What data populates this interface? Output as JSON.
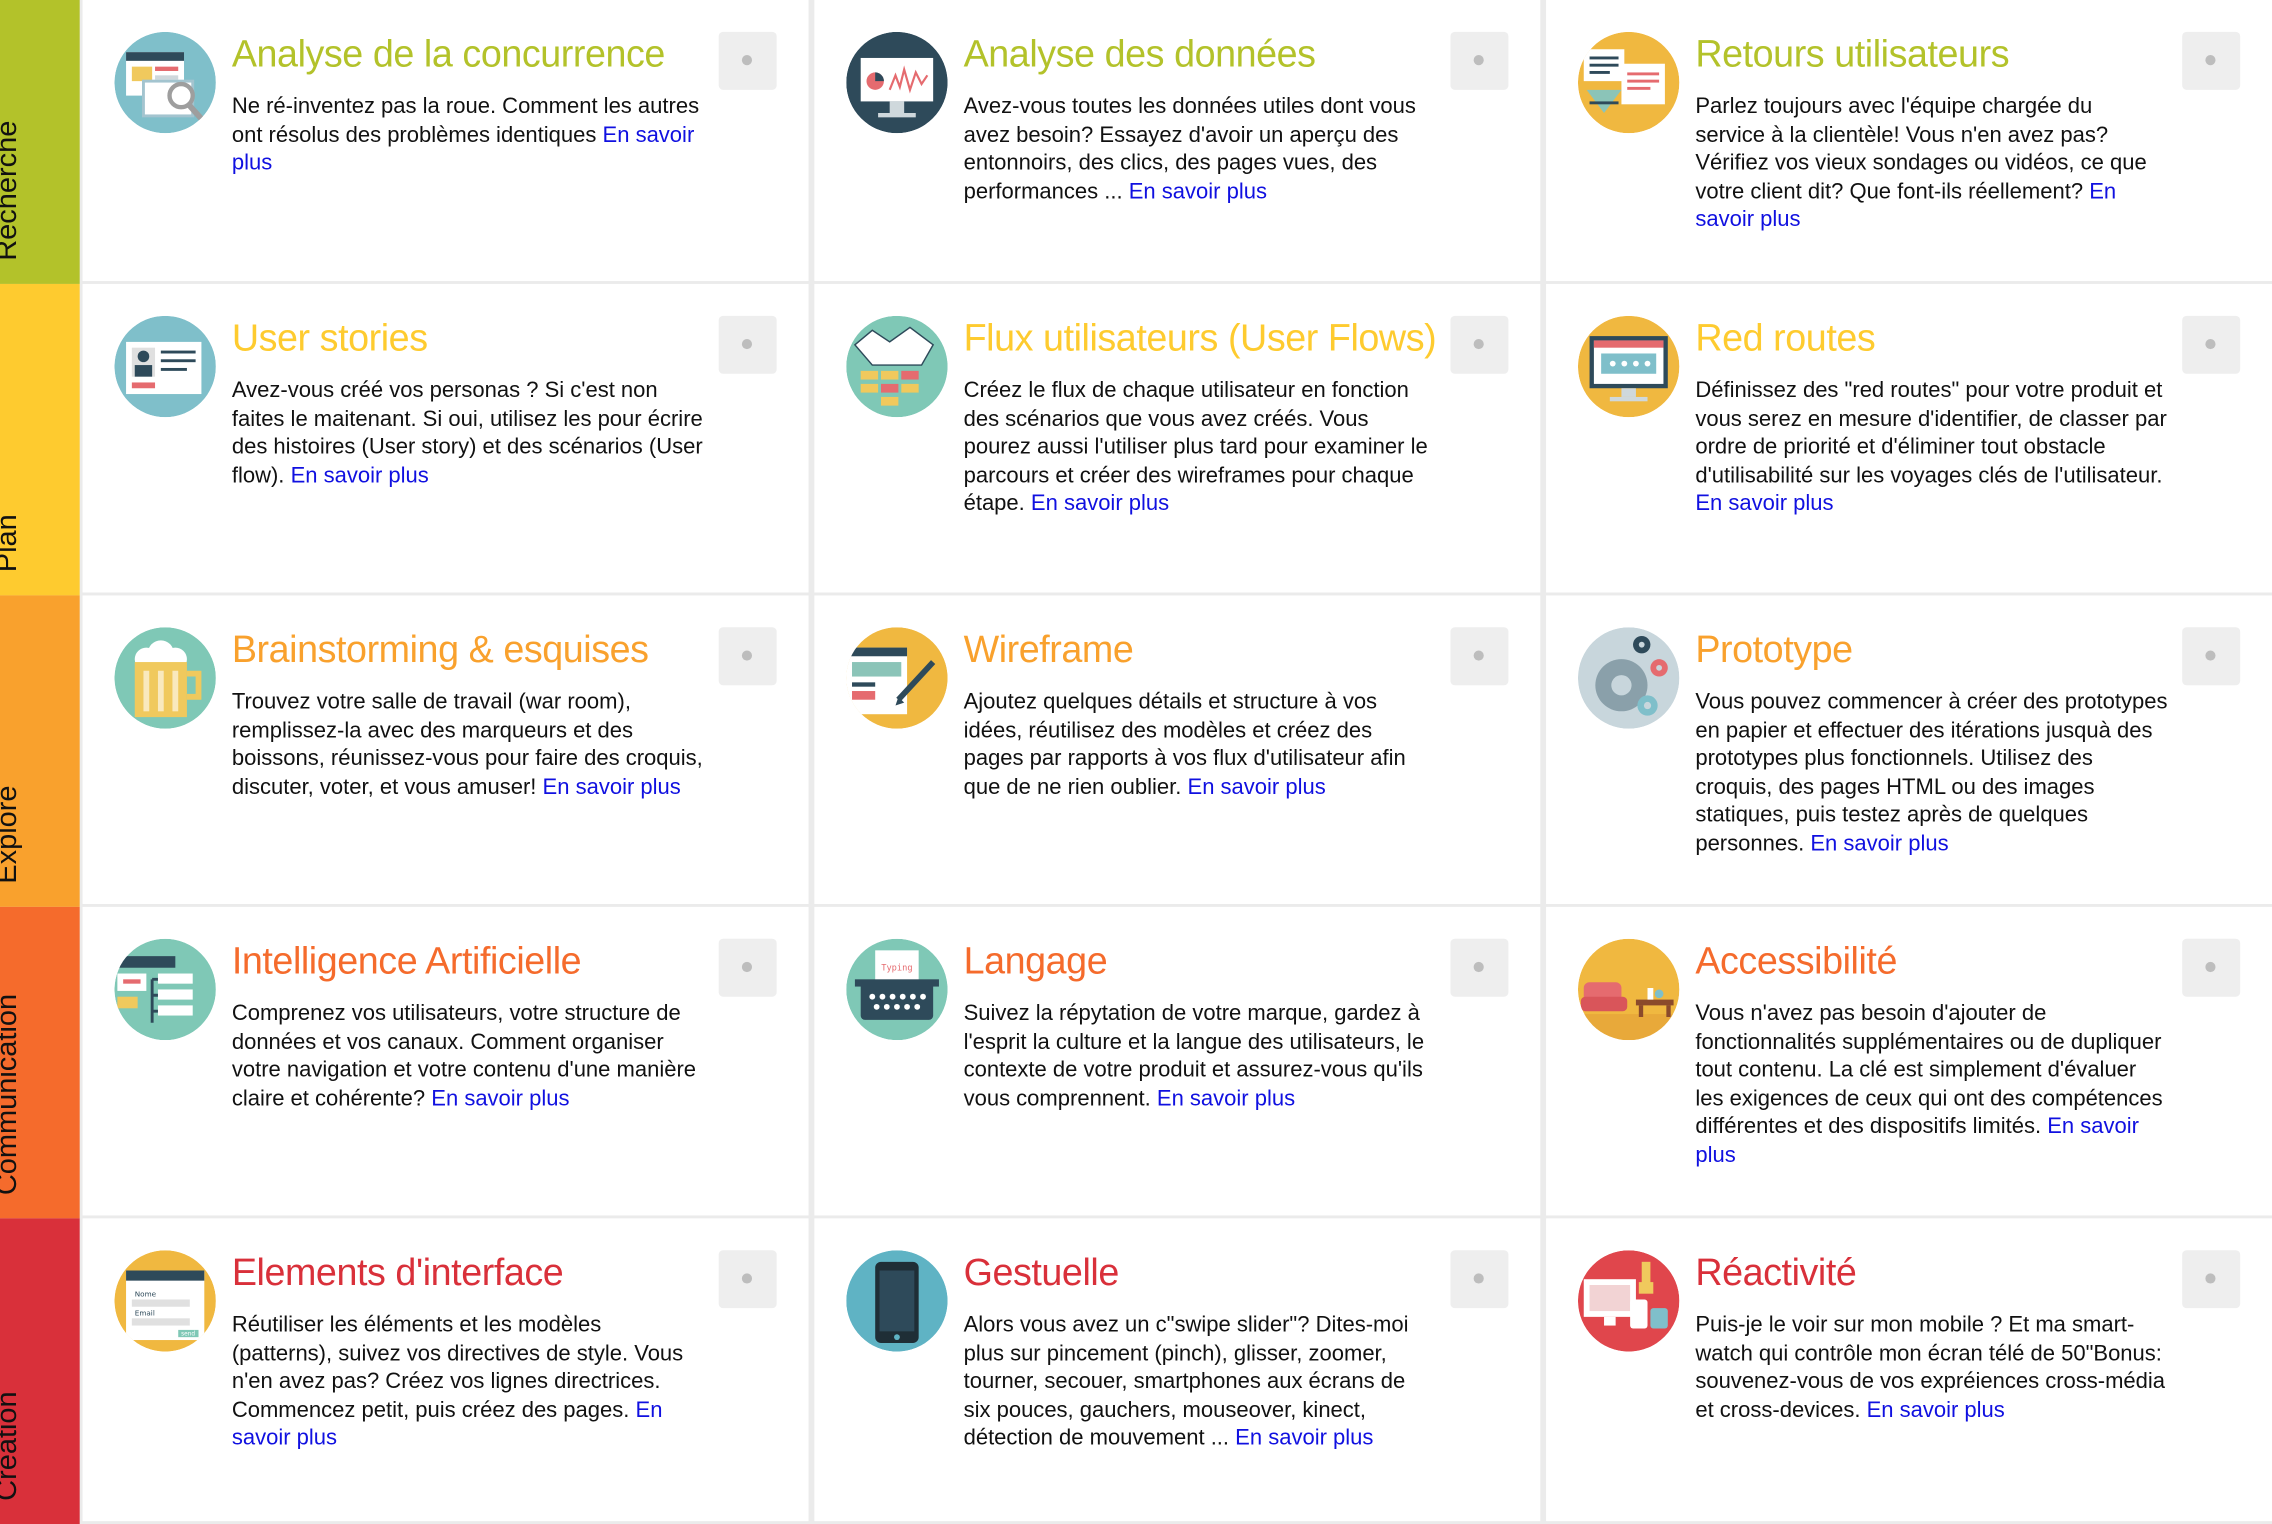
{
  "colors": {
    "recherche": "#b3c22a",
    "plan": "#fecb2f",
    "explore": "#f9a12d",
    "communication": "#f56b2c",
    "creation": "#d9303a",
    "link": "#1010e0"
  },
  "phases": [
    {
      "label": "Recherche",
      "cards": [
        {
          "icon": "competition-analysis-icon",
          "title": "Analyse de la concurrence",
          "text": "Ne ré-inventez pas la roue. Comment les autres ont résolus des problèmes identiques",
          "link": "En savoir plus"
        },
        {
          "icon": "data-analysis-icon",
          "title": "Analyse des données",
          "text": "Avez-vous toutes les données utiles dont vous avez besoin? Essayez d'avoir un aperçu des entonnoirs, des clics, des pages vues, des performances ...",
          "link": "En savoir plus"
        },
        {
          "icon": "user-feedback-icon",
          "title": "Retours utilisateurs",
          "text": "Parlez toujours avec l'équipe chargée du service à la clientèle! Vous n'en avez pas? Vérifiez vos vieux sondages ou vidéos, ce que votre client dit? Que font-ils réellement?",
          "link": "En savoir plus"
        }
      ]
    },
    {
      "label": "Plan",
      "cards": [
        {
          "icon": "user-stories-icon",
          "title": "User stories",
          "text": "Avez-vous créé vos personas ? Si c'est non faites le maitenant. Si oui, utilisez les pour écrire des histoires (User story) et des scénarios (User flow).",
          "link": "En savoir plus"
        },
        {
          "icon": "user-flows-icon",
          "title": "Flux utilisateurs (User Flows)",
          "text": "Créez le flux de chaque utilisateur en fonction des scénarios que vous avez créés. Vous pourez aussi l'utiliser plus tard pour examiner le parcours et créer des wireframes pour chaque étape.",
          "link": "En savoir plus"
        },
        {
          "icon": "red-routes-icon",
          "title": "Red routes",
          "text": "Définissez des \"red routes\" pour votre produit et vous serez en mesure d'identifier, de classer par ordre de priorité et d'éliminer tout obstacle d'utilisabilité sur les voyages clés de l'utilisateur.",
          "link": "En savoir plus"
        }
      ]
    },
    {
      "label": "Explore",
      "cards": [
        {
          "icon": "brainstorming-icon",
          "title": "Brainstorming & esquises",
          "text": "Trouvez votre salle de travail (war room), remplissez-la avec des marqueurs et des boissons, réunissez-vous pour faire des croquis, discuter, voter, et vous amuser!",
          "link": "En savoir plus"
        },
        {
          "icon": "wireframe-icon",
          "title": "Wireframe",
          "text": "Ajoutez quelques détails et structure à vos idées, réutilisez des modèles et créez des pages par rapports à vos flux d'utilisateur afin que de ne rien oublier.",
          "link": "En savoir plus"
        },
        {
          "icon": "prototype-gears-icon",
          "title": "Prototype",
          "text": "Vous pouvez commencer à créer des prototypes en papier et effectuer des itérations jusquà des prototypes plus fonctionnels. Utilisez des croquis, des pages HTML ou des images statiques, puis testez après de quelques personnes.",
          "link": "En savoir plus"
        }
      ]
    },
    {
      "label": "Communication",
      "cards": [
        {
          "icon": "information-architecture-icon",
          "title": "Intelligence Artificielle",
          "text": "Comprenez vos utilisateurs, votre structure de données et vos canaux. Comment organiser votre navigation et votre contenu d'une manière claire et cohérente?",
          "link": "En savoir plus"
        },
        {
          "icon": "typewriter-icon",
          "title": "Langage",
          "text": "Suivez la répytation de votre marque, gardez à l'esprit la culture et la langue des utilisateurs, le contexte de votre produit et assurez-vous qu'ils vous comprennent.",
          "link": "En savoir plus",
          "icon_text": "Typing"
        },
        {
          "icon": "accessibility-room-icon",
          "title": "Accessibilité",
          "text": "Vous n'avez pas besoin d'ajouter de fonctionnalités supplémentaires ou de dupliquer tout contenu. La clé est simplement d'évaluer les exigences de ceux qui ont des compétences différentes et des dispositifs limités.",
          "link": "En savoir plus"
        }
      ]
    },
    {
      "label": "Création",
      "cards": [
        {
          "icon": "interface-form-icon",
          "title": "Elements d'interface",
          "text": "Réutiliser les éléments et les modèles (patterns), suivez vos directives de style. Vous n'en avez pas? Créez vos lignes directrices. Commencez petit, puis créez des pages.",
          "link": "En savoir plus",
          "icon_text": [
            "Nome",
            "Email",
            "send"
          ]
        },
        {
          "icon": "smartphone-gesture-icon",
          "title": "Gestuelle",
          "text": "Alors vous avez un c\"swipe slider\"? Dites-moi plus sur pincement (pinch), glisser, zoomer, tourner, secouer, smartphones aux écrans de six pouces, gauchers, mouseover, kinect, détection de mouvement ...",
          "link": "En savoir plus"
        },
        {
          "icon": "responsive-devices-icon",
          "title": "Réactivité",
          "text": "Puis-je le voir sur mon mobile ? Et ma smart-watch qui contrôle mon écran télé de 50\"Bonus: souvenez-vous de vos expréiences cross-média et cross-devices.",
          "link": "En savoir plus"
        }
      ]
    }
  ]
}
